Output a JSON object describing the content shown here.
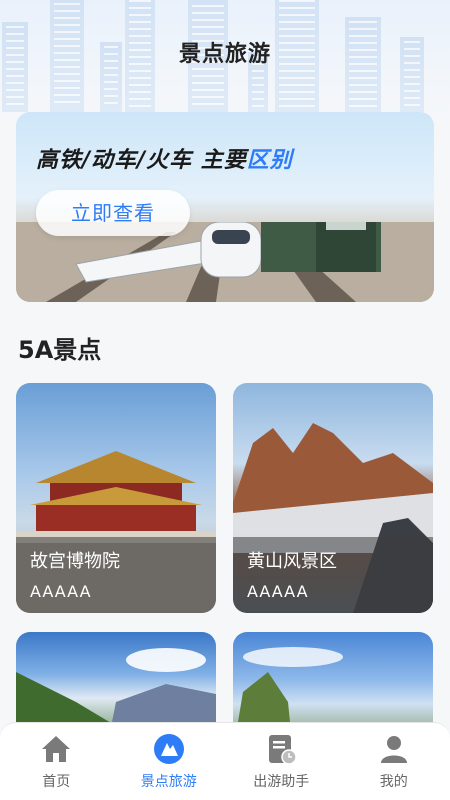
{
  "header": {
    "title": "景点旅游"
  },
  "banner": {
    "headline_main": "高铁/动车/火车  主要",
    "headline_highlight": "区别",
    "cta_label": "立即查看"
  },
  "section": {
    "title": "5A景点"
  },
  "attractions": [
    {
      "name": "故宫博物院",
      "rating": "AAAAA"
    },
    {
      "name": "黄山风景区",
      "rating": "AAAAA"
    }
  ],
  "tabbar": {
    "active_color": "#2f7df6",
    "inactive_color": "#666666",
    "items": [
      {
        "label": "首页",
        "icon": "home-icon",
        "active": false
      },
      {
        "label": "景点旅游",
        "icon": "mountain-icon",
        "active": true
      },
      {
        "label": "出游助手",
        "icon": "document-clock-icon",
        "active": false
      },
      {
        "label": "我的",
        "icon": "user-icon",
        "active": false
      }
    ]
  }
}
